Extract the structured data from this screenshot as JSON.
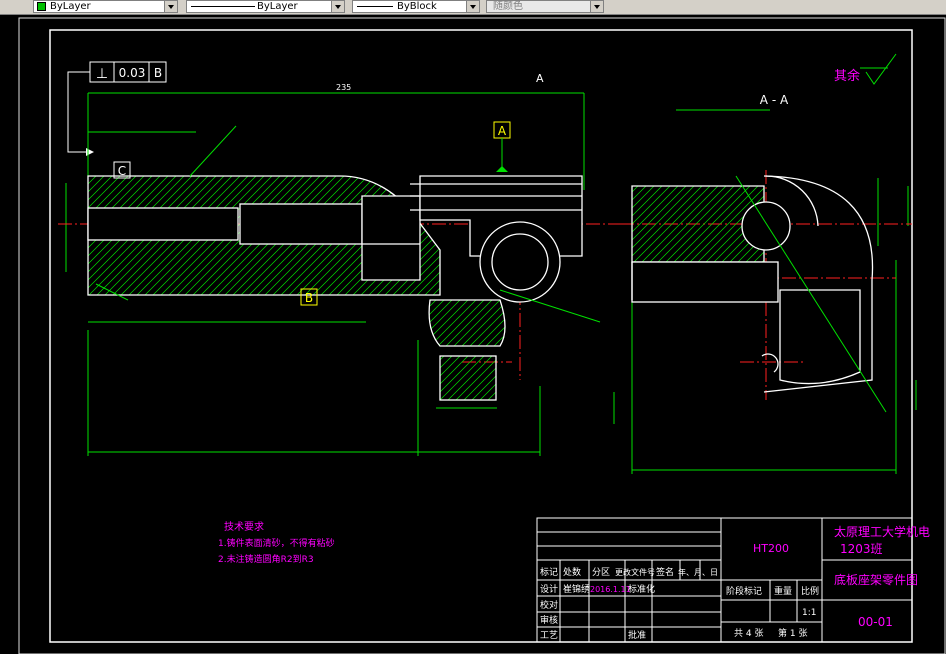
{
  "toolbar": {
    "color_combo": "ByLayer",
    "linetype_combo": "ByLayer",
    "lineweight_combo": "ByBlock",
    "plotstyle_combo": "随颜色"
  },
  "drawing": {
    "tol_frame": {
      "symbol": "⊥",
      "value": "0.03",
      "datum": "B"
    },
    "datum_a": "A",
    "datum_b": "B",
    "datum_c": "C",
    "section_label": "A - A",
    "section_mark": "A",
    "others_label": "其余",
    "dim_overall": "235",
    "tech_title": "技术要求",
    "tech_line1": "1.铸件表面清砂，不得有粘砂",
    "tech_line2": "2.未注铸造圆角R2到R3",
    "title_block": {
      "material": "HT200",
      "school_line1": "太原理工大学机电",
      "school_line2": "1203班",
      "part_name": "底板座架零件图",
      "drawing_no": "00-01",
      "row_labels": [
        "标记",
        "处数",
        "分区",
        "更改文件号",
        "签名",
        "年、月、日"
      ],
      "designer_label": "设计",
      "designer_name": "崔锦绣",
      "date": "2016.1.11",
      "standard_label": "标准化",
      "stage_label": "阶段标记",
      "weight_label": "重量",
      "scale_label": "比例",
      "scale_value": "1:1",
      "check_label": "校对",
      "review_label": "审核",
      "process_label": "工艺",
      "approve_label": "批准",
      "sheets": "共 4 张",
      "sheet_no": "第 1 张"
    }
  }
}
